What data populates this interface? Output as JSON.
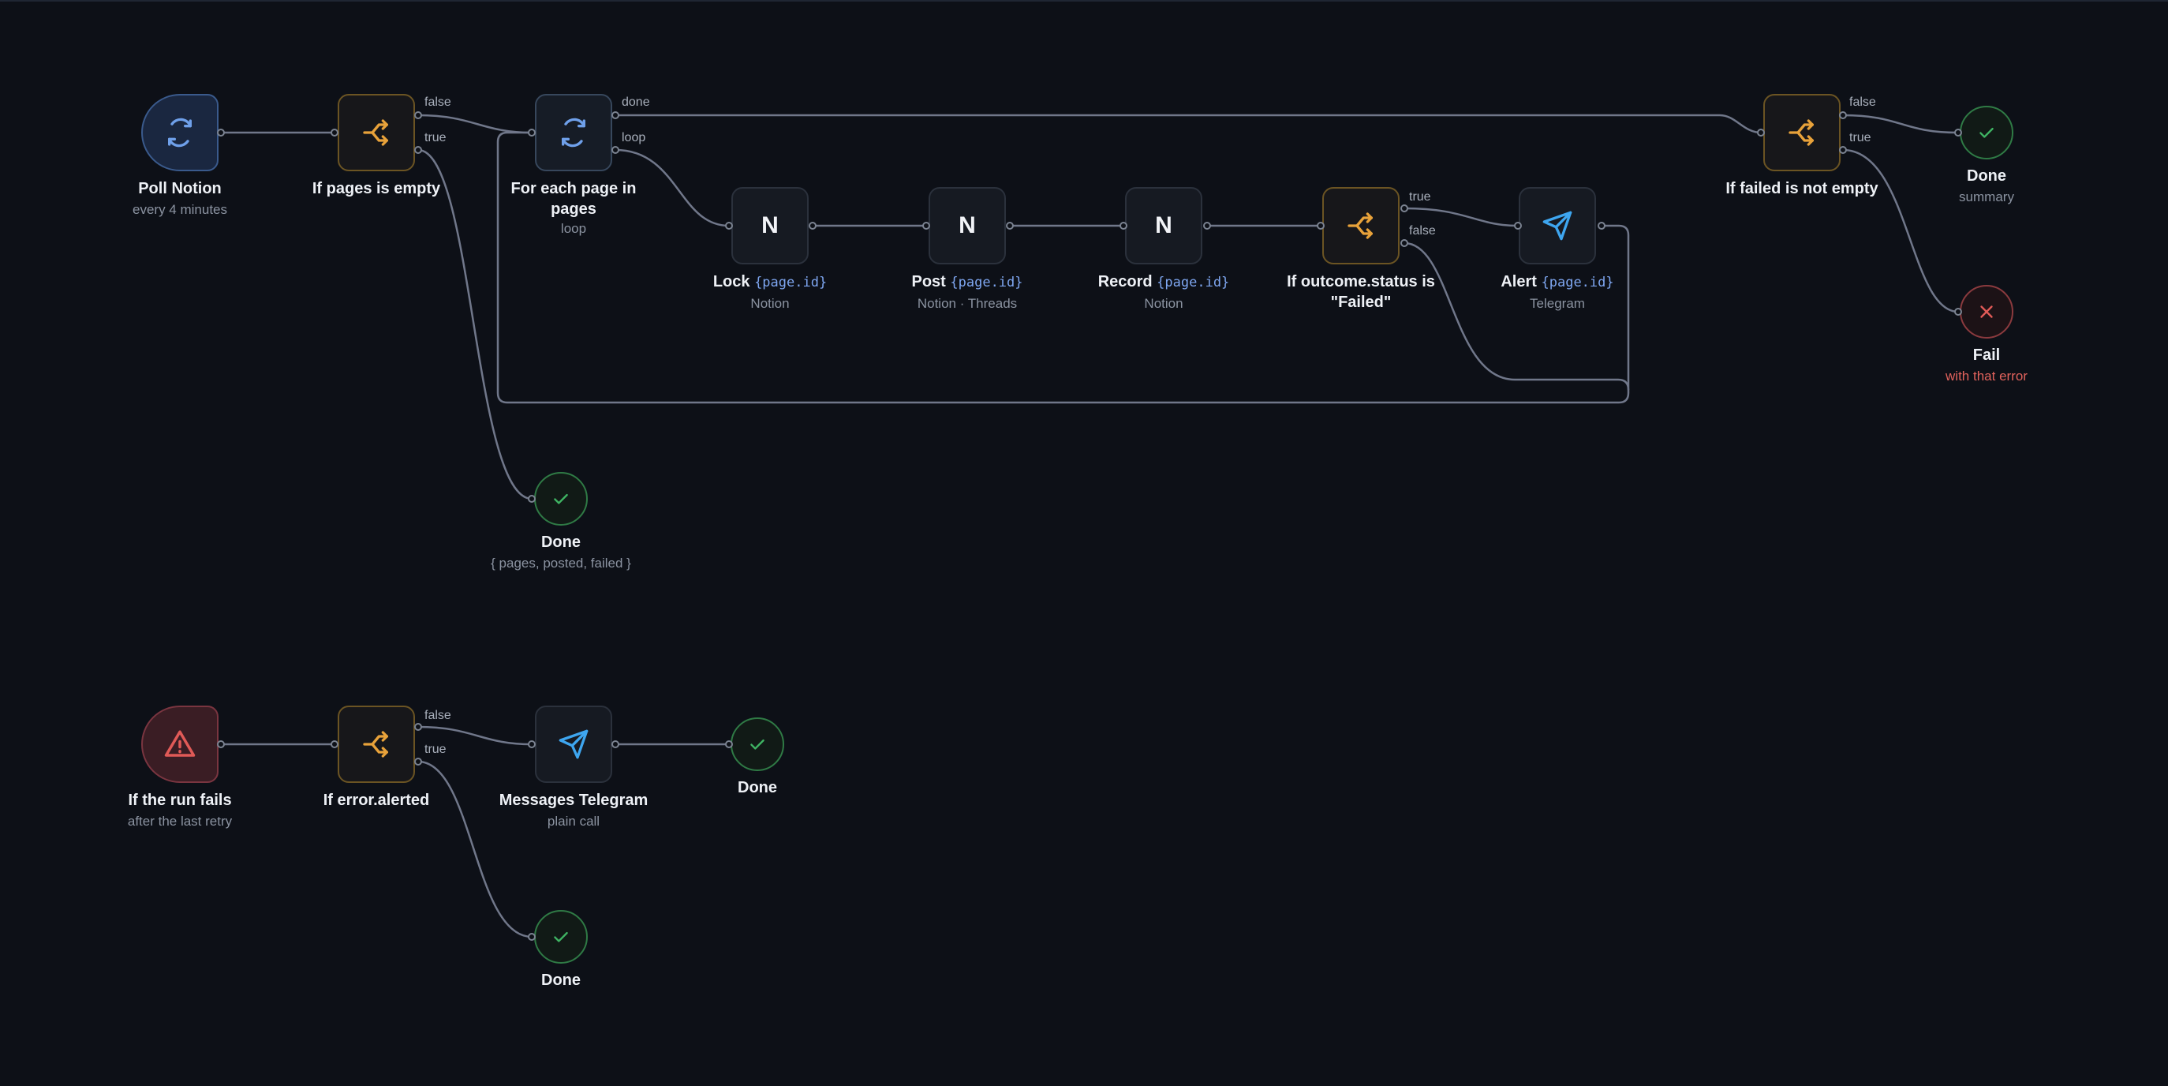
{
  "nodes": {
    "poll": {
      "title": "Poll Notion",
      "sub": "every 4 minutes"
    },
    "if_empty": {
      "title": "If pages is empty"
    },
    "foreach": {
      "title1": "For each page in",
      "title2": "pages",
      "sub": "loop"
    },
    "lock": {
      "title": "Lock",
      "code": "{page.id}",
      "sub": "Notion",
      "letter": "N"
    },
    "post": {
      "title": "Post",
      "code": "{page.id}",
      "sub": "Notion · Threads",
      "letter": "N"
    },
    "record": {
      "title": "Record",
      "code": "{page.id}",
      "sub": "Notion",
      "letter": "N"
    },
    "if_outcome": {
      "title1": "If outcome.status is",
      "title2": "\"Failed\""
    },
    "alert": {
      "title": "Alert",
      "code": "{page.id}",
      "sub": "Telegram"
    },
    "if_failed": {
      "title": "If failed is not empty"
    },
    "done_summary": {
      "title": "Done",
      "sub": "summary"
    },
    "fail": {
      "title": "Fail",
      "sub": "with that error"
    },
    "done_pages": {
      "title": "Done",
      "sub": "{ pages, posted, failed }"
    },
    "run_fails": {
      "title": "If the run fails",
      "sub": "after the last retry"
    },
    "if_alerted": {
      "title": "If error.alerted"
    },
    "msg_telegram": {
      "title": "Messages Telegram",
      "sub": "plain call"
    },
    "done_msg": {
      "title": "Done"
    },
    "done_alerted": {
      "title": "Done"
    }
  },
  "edges": {
    "if_empty_false": "false",
    "if_empty_true": "true",
    "foreach_done": "done",
    "foreach_loop": "loop",
    "outcome_true": "true",
    "outcome_false": "false",
    "failed_false": "false",
    "failed_true": "true",
    "alerted_false": "false",
    "alerted_true": "true"
  },
  "icons": {
    "trigger": "refresh-icon",
    "condition": "branch-icon",
    "loop": "refresh-icon",
    "notion": "notion-icon",
    "telegram": "telegram-icon",
    "success": "check-icon",
    "fail": "x-icon",
    "error": "warning-icon"
  },
  "colors": {
    "background": "#0d1017",
    "wire": "#70778a",
    "condition": "#e8a23a",
    "trigger": "#6fa0ea",
    "telegram": "#3ea6f0",
    "success": "#3fb463",
    "fail": "#e05a57"
  }
}
